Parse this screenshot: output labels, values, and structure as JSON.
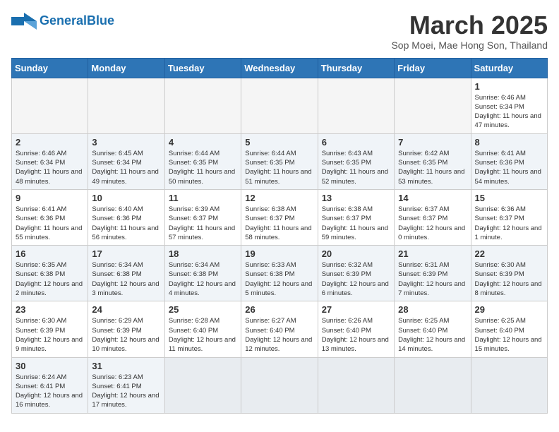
{
  "header": {
    "logo_text_normal": "General",
    "logo_text_bold": "Blue",
    "month_title": "March 2025",
    "location": "Sop Moei, Mae Hong Son, Thailand"
  },
  "days_of_week": [
    "Sunday",
    "Monday",
    "Tuesday",
    "Wednesday",
    "Thursday",
    "Friday",
    "Saturday"
  ],
  "weeks": [
    {
      "days": [
        {
          "date": "",
          "info": ""
        },
        {
          "date": "",
          "info": ""
        },
        {
          "date": "",
          "info": ""
        },
        {
          "date": "",
          "info": ""
        },
        {
          "date": "",
          "info": ""
        },
        {
          "date": "",
          "info": ""
        },
        {
          "date": "1",
          "info": "Sunrise: 6:46 AM\nSunset: 6:34 PM\nDaylight: 11 hours and 47 minutes."
        }
      ]
    },
    {
      "days": [
        {
          "date": "2",
          "info": "Sunrise: 6:46 AM\nSunset: 6:34 PM\nDaylight: 11 hours and 48 minutes."
        },
        {
          "date": "3",
          "info": "Sunrise: 6:45 AM\nSunset: 6:34 PM\nDaylight: 11 hours and 49 minutes."
        },
        {
          "date": "4",
          "info": "Sunrise: 6:44 AM\nSunset: 6:35 PM\nDaylight: 11 hours and 50 minutes."
        },
        {
          "date": "5",
          "info": "Sunrise: 6:44 AM\nSunset: 6:35 PM\nDaylight: 11 hours and 51 minutes."
        },
        {
          "date": "6",
          "info": "Sunrise: 6:43 AM\nSunset: 6:35 PM\nDaylight: 11 hours and 52 minutes."
        },
        {
          "date": "7",
          "info": "Sunrise: 6:42 AM\nSunset: 6:35 PM\nDaylight: 11 hours and 53 minutes."
        },
        {
          "date": "8",
          "info": "Sunrise: 6:41 AM\nSunset: 6:36 PM\nDaylight: 11 hours and 54 minutes."
        }
      ]
    },
    {
      "days": [
        {
          "date": "9",
          "info": "Sunrise: 6:41 AM\nSunset: 6:36 PM\nDaylight: 11 hours and 55 minutes."
        },
        {
          "date": "10",
          "info": "Sunrise: 6:40 AM\nSunset: 6:36 PM\nDaylight: 11 hours and 56 minutes."
        },
        {
          "date": "11",
          "info": "Sunrise: 6:39 AM\nSunset: 6:37 PM\nDaylight: 11 hours and 57 minutes."
        },
        {
          "date": "12",
          "info": "Sunrise: 6:38 AM\nSunset: 6:37 PM\nDaylight: 11 hours and 58 minutes."
        },
        {
          "date": "13",
          "info": "Sunrise: 6:38 AM\nSunset: 6:37 PM\nDaylight: 11 hours and 59 minutes."
        },
        {
          "date": "14",
          "info": "Sunrise: 6:37 AM\nSunset: 6:37 PM\nDaylight: 12 hours and 0 minutes."
        },
        {
          "date": "15",
          "info": "Sunrise: 6:36 AM\nSunset: 6:37 PM\nDaylight: 12 hours and 1 minute."
        }
      ]
    },
    {
      "days": [
        {
          "date": "16",
          "info": "Sunrise: 6:35 AM\nSunset: 6:38 PM\nDaylight: 12 hours and 2 minutes."
        },
        {
          "date": "17",
          "info": "Sunrise: 6:34 AM\nSunset: 6:38 PM\nDaylight: 12 hours and 3 minutes."
        },
        {
          "date": "18",
          "info": "Sunrise: 6:34 AM\nSunset: 6:38 PM\nDaylight: 12 hours and 4 minutes."
        },
        {
          "date": "19",
          "info": "Sunrise: 6:33 AM\nSunset: 6:38 PM\nDaylight: 12 hours and 5 minutes."
        },
        {
          "date": "20",
          "info": "Sunrise: 6:32 AM\nSunset: 6:39 PM\nDaylight: 12 hours and 6 minutes."
        },
        {
          "date": "21",
          "info": "Sunrise: 6:31 AM\nSunset: 6:39 PM\nDaylight: 12 hours and 7 minutes."
        },
        {
          "date": "22",
          "info": "Sunrise: 6:30 AM\nSunset: 6:39 PM\nDaylight: 12 hours and 8 minutes."
        }
      ]
    },
    {
      "days": [
        {
          "date": "23",
          "info": "Sunrise: 6:30 AM\nSunset: 6:39 PM\nDaylight: 12 hours and 9 minutes."
        },
        {
          "date": "24",
          "info": "Sunrise: 6:29 AM\nSunset: 6:39 PM\nDaylight: 12 hours and 10 minutes."
        },
        {
          "date": "25",
          "info": "Sunrise: 6:28 AM\nSunset: 6:40 PM\nDaylight: 12 hours and 11 minutes."
        },
        {
          "date": "26",
          "info": "Sunrise: 6:27 AM\nSunset: 6:40 PM\nDaylight: 12 hours and 12 minutes."
        },
        {
          "date": "27",
          "info": "Sunrise: 6:26 AM\nSunset: 6:40 PM\nDaylight: 12 hours and 13 minutes."
        },
        {
          "date": "28",
          "info": "Sunrise: 6:25 AM\nSunset: 6:40 PM\nDaylight: 12 hours and 14 minutes."
        },
        {
          "date": "29",
          "info": "Sunrise: 6:25 AM\nSunset: 6:40 PM\nDaylight: 12 hours and 15 minutes."
        }
      ]
    },
    {
      "days": [
        {
          "date": "30",
          "info": "Sunrise: 6:24 AM\nSunset: 6:41 PM\nDaylight: 12 hours and 16 minutes."
        },
        {
          "date": "31",
          "info": "Sunrise: 6:23 AM\nSunset: 6:41 PM\nDaylight: 12 hours and 17 minutes."
        },
        {
          "date": "",
          "info": ""
        },
        {
          "date": "",
          "info": ""
        },
        {
          "date": "",
          "info": ""
        },
        {
          "date": "",
          "info": ""
        },
        {
          "date": "",
          "info": ""
        }
      ]
    }
  ]
}
